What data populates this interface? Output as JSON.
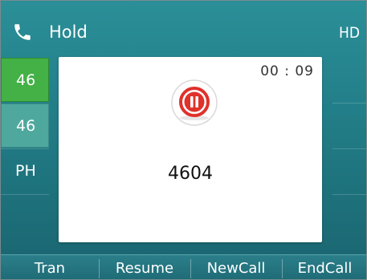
{
  "titlebar": {
    "call_state": "Hold",
    "hd_label": "HD",
    "icon": "phone-handset-icon"
  },
  "line_keys": [
    {
      "label": "46",
      "state": "active"
    },
    {
      "label": "46",
      "state": "selected"
    },
    {
      "label": "PH",
      "state": "normal"
    },
    {
      "label": "",
      "state": "empty"
    }
  ],
  "call": {
    "timer": "00 : 09",
    "status_icon": "pause-icon",
    "number": "4604"
  },
  "softkeys": [
    "Tran",
    "Resume",
    "NewCall",
    "EndCall"
  ],
  "colors": {
    "accent_green": "#43b146",
    "hold_red": "#e0312b",
    "background_teal": "#227e88"
  }
}
